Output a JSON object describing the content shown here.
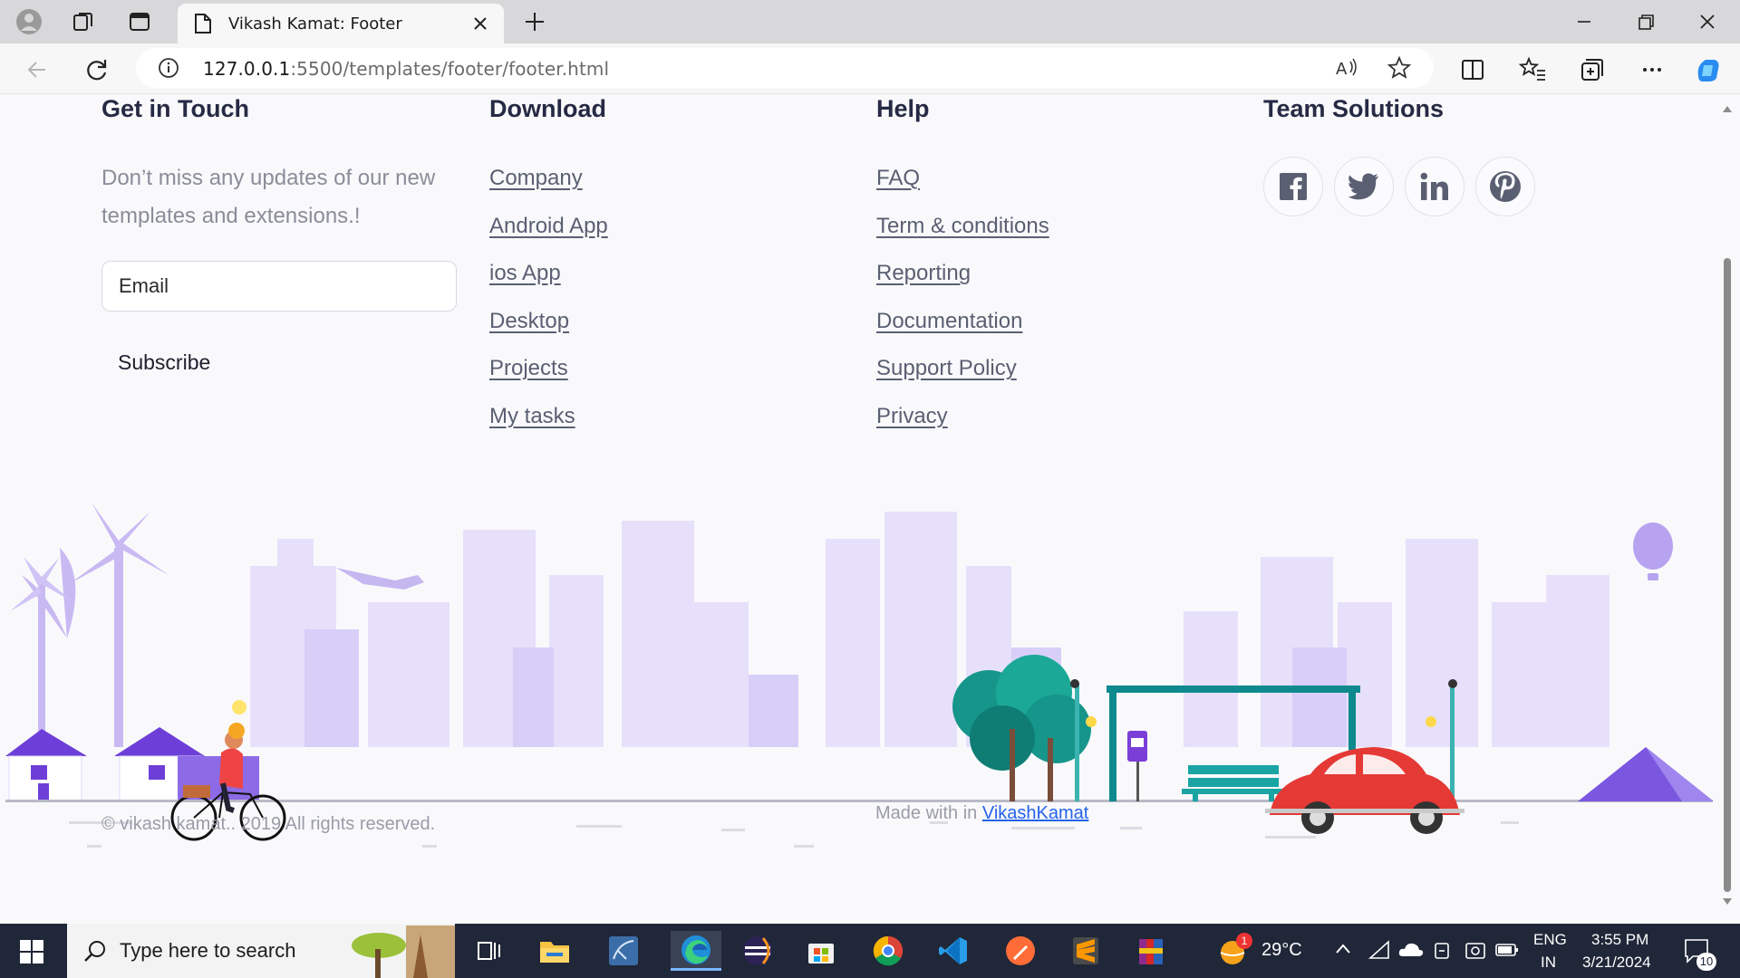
{
  "browser": {
    "tab_title": "Vikash Kamat: Footer",
    "url_host": "127.0.0.1",
    "url_rest": ":5500/templates/footer/footer.html"
  },
  "footer": {
    "get_in_touch": {
      "heading": "Get in Touch",
      "intro": "Don’t miss any updates of our new templates and extensions.!",
      "email_placeholder": "Email",
      "subscribe_label": "Subscribe"
    },
    "download": {
      "heading": "Download",
      "links": [
        "Company",
        "Android App",
        "ios App",
        "Desktop",
        "Projects",
        "My tasks"
      ]
    },
    "help": {
      "heading": "Help",
      "links": [
        "FAQ",
        "Term & conditions",
        "Reporting",
        "Documentation",
        "Support Policy",
        "Privacy"
      ]
    },
    "team": {
      "heading": "Team Solutions",
      "social": [
        "facebook-icon",
        "twitter-icon",
        "linkedin-icon",
        "pinterest-icon"
      ]
    },
    "copyright": "© vikash kamat.. 2019 All rights reserved.",
    "made_with_prefix": "Made with in",
    "made_with_link": "VikashKamat"
  },
  "taskbar": {
    "search_placeholder": "Type here to search",
    "weather": "29°C",
    "weather_badge": "1",
    "lang_top": "ENG",
    "lang_bottom": "IN",
    "time": "3:55 PM",
    "date": "3/21/2024",
    "notif_count": "10"
  },
  "colors": {
    "heading": "#262a44",
    "link": "#5a5f72",
    "accent_blue": "#2563eb",
    "illustration_lavender": "#e3dcfb",
    "car_red": "#e53935",
    "bus_stop_teal": "#0e8a8f"
  }
}
